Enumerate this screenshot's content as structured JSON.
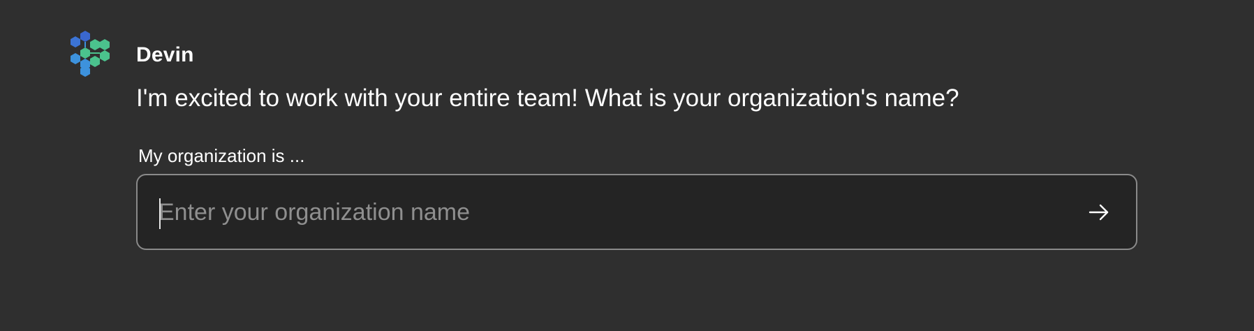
{
  "message": {
    "sender": "Devin",
    "text": "I'm excited to work with your entire team! What is your organization's name?"
  },
  "form": {
    "label": "My organization is ...",
    "placeholder": "Enter your organization name",
    "value": "",
    "submit_icon": "arrow-right-icon"
  },
  "avatar": {
    "icon": "devin-hexagon-logo-icon",
    "colors": {
      "blue_dark": "#3a67cf",
      "blue_light": "#3d92dd",
      "green": "#4bc28d"
    }
  },
  "theme": {
    "background": "#2f2f2f",
    "input_background": "#242424",
    "input_border": "#8a8a8a",
    "placeholder": "#8f8f8f"
  }
}
